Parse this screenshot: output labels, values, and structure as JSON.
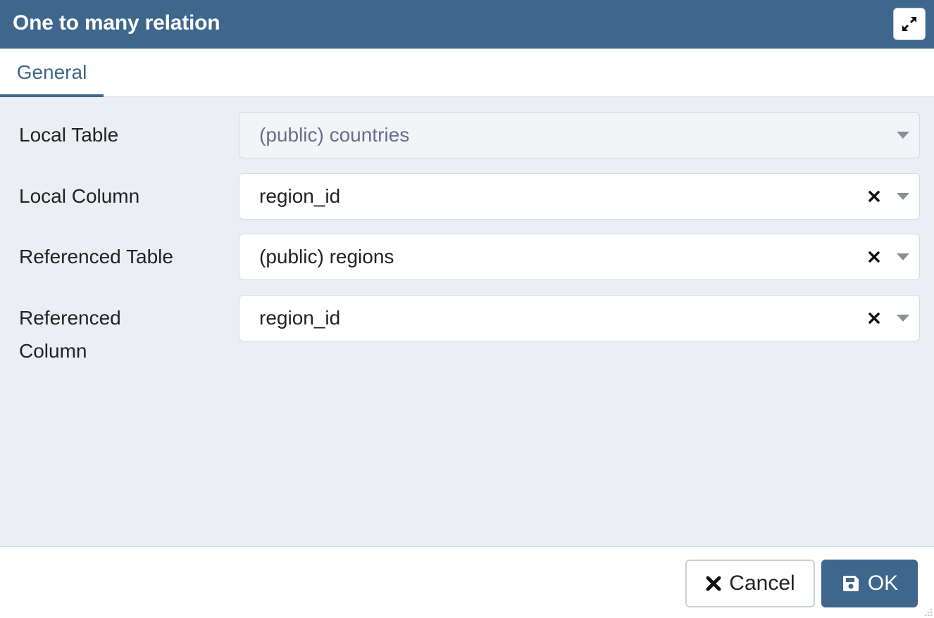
{
  "dialog": {
    "title": "One to many relation"
  },
  "tabs": [
    {
      "label": "General"
    }
  ],
  "fields": [
    {
      "label": "Local Table",
      "value": "(public) countries"
    },
    {
      "label": "Local Column",
      "value": "region_id"
    },
    {
      "label": "Referenced Table",
      "value": "(public) regions"
    },
    {
      "label_line1": "Referenced",
      "label_line2": "Column",
      "value": "region_id"
    }
  ],
  "footer": {
    "cancel_label": "Cancel",
    "ok_label": "OK"
  },
  "colors": {
    "header_bg": "#3f668c",
    "content_bg": "#ebeef3",
    "accent": "#3f668c"
  },
  "icons": [
    "maximize-icon",
    "clear-icon",
    "chevron-down-icon",
    "close-icon",
    "save-icon",
    "resize-grip-icon"
  ]
}
